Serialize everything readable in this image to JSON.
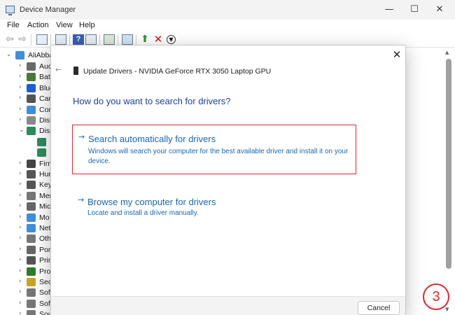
{
  "window": {
    "title": "Device Manager",
    "controls": {
      "minimize": "—",
      "maximize": "☐",
      "close": "✕"
    }
  },
  "menu": [
    "File",
    "Action",
    "View",
    "Help"
  ],
  "toolbar": {
    "back_icon": "back-arrow-icon",
    "forward_icon": "forward-arrow-icon",
    "help_glyph": "?"
  },
  "tree": {
    "root": {
      "label": "AliAbba",
      "icon": "computer-icon"
    },
    "items": [
      {
        "label": "Aud",
        "icon": "audio-icon",
        "color": "#6b6b6b",
        "chevron": "›"
      },
      {
        "label": "Batt",
        "icon": "battery-icon",
        "color": "#4a7a3a",
        "chevron": "›"
      },
      {
        "label": "Blue",
        "icon": "bluetooth-icon",
        "color": "#1f5fcf",
        "chevron": "›"
      },
      {
        "label": "Cam",
        "icon": "camera-icon",
        "color": "#555555",
        "chevron": "›"
      },
      {
        "label": "Com",
        "icon": "computer-icon",
        "color": "#3f8fd8",
        "chevron": "›"
      },
      {
        "label": "Disk",
        "icon": "disk-icon",
        "color": "#8a8a8a",
        "chevron": "›"
      },
      {
        "label": "Disp",
        "icon": "display-icon",
        "color": "#2f8a5f",
        "chevron": "⌄"
      },
      {
        "label": "",
        "icon": "display-adapter-icon",
        "color": "#2f8a5f",
        "chevron": ""
      },
      {
        "label": "",
        "icon": "display-adapter-icon",
        "color": "#2f8a5f",
        "chevron": ""
      },
      {
        "label": "Firm",
        "icon": "firmware-icon",
        "color": "#444444",
        "chevron": "›"
      },
      {
        "label": "Hun",
        "icon": "hid-icon",
        "color": "#555555",
        "chevron": "›"
      },
      {
        "label": "Key",
        "icon": "keyboard-icon",
        "color": "#555555",
        "chevron": "›"
      },
      {
        "label": "Mer",
        "icon": "memory-icon",
        "color": "#777777",
        "chevron": "›"
      },
      {
        "label": "Mic",
        "icon": "mouse-icon",
        "color": "#666666",
        "chevron": "›"
      },
      {
        "label": "Mo",
        "icon": "monitor-icon",
        "color": "#3f8fd8",
        "chevron": "›"
      },
      {
        "label": "Net",
        "icon": "network-icon",
        "color": "#3f8fd8",
        "chevron": "›"
      },
      {
        "label": "Oth",
        "icon": "other-devices-icon",
        "color": "#777777",
        "chevron": "›"
      },
      {
        "label": "Port",
        "icon": "port-icon",
        "color": "#666666",
        "chevron": "›"
      },
      {
        "label": "Prin",
        "icon": "printer-icon",
        "color": "#555555",
        "chevron": "›"
      },
      {
        "label": "Proc",
        "icon": "processor-icon",
        "color": "#2f7a2f",
        "chevron": "›"
      },
      {
        "label": "Secu",
        "icon": "security-icon",
        "color": "#c9a227",
        "chevron": "›"
      },
      {
        "label": "Soft",
        "icon": "software-icon",
        "color": "#777777",
        "chevron": "›"
      },
      {
        "label": "Soft",
        "icon": "software-icon",
        "color": "#777777",
        "chevron": "›"
      },
      {
        "label": "Sour",
        "icon": "sound-icon",
        "color": "#777777",
        "chevron": "›"
      }
    ]
  },
  "dialog": {
    "title": "Update Drivers - NVIDIA GeForce RTX 3050 Laptop GPU",
    "question": "How do you want to search for drivers?",
    "option_auto": {
      "title": "Search automatically for drivers",
      "description": "Windows will search your computer for the best available driver and install it on your device."
    },
    "option_browse": {
      "title": "Browse my computer for drivers",
      "description": "Locate and install a driver manually."
    },
    "cancel_label": "Cancel",
    "close_glyph": "✕",
    "back_glyph": "←",
    "option_arrow": "→"
  },
  "step_badge": "3",
  "colors": {
    "link_blue": "#1766b3",
    "heading_blue": "#1f3f9a",
    "highlight_red": "#e0262c"
  }
}
